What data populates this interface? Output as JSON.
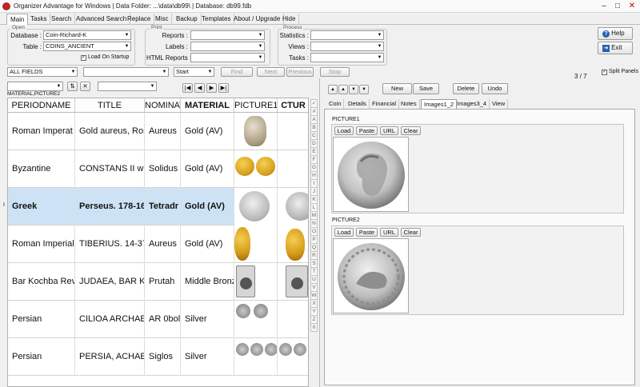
{
  "titlebar": {
    "title": "Organizer Advantage for Windows | Data Folder: ...\\data\\db99\\ | Database: db99.fdb",
    "minimize": "–",
    "maximize": "□",
    "close": "✕"
  },
  "menu_tabs": [
    "Main",
    "Tasks",
    "Search",
    "Advanced Search",
    "Replace",
    "Misc",
    "Backup",
    "Templates",
    "About / Upgrade",
    "Hide"
  ],
  "open_group": {
    "label": "Open",
    "database_label": "Database :",
    "database_value": "Coin-Richard-K",
    "table_label": "Table :",
    "table_value": "COINS_ANCIENT",
    "load_on_startup": "Load On Startup"
  },
  "print_group": {
    "label": "Print",
    "reports": "Reports :",
    "labels": "Labels :",
    "html_reports": "HTML Reports :"
  },
  "process_group": {
    "label": "Process",
    "statistics": "Statistics :",
    "views": "Views :",
    "tasks": "Tasks :"
  },
  "help_label": "Help",
  "exit_label": "Exit",
  "search": {
    "field": "ALL FIELDS",
    "mode": "Start",
    "find": "Find",
    "next": "Next",
    "previous": "Previous",
    "stop": "Stop"
  },
  "record_counter": "3 / 7",
  "split_panels": "Split Panels",
  "sort_label": "MATERIAL,PICTURE2",
  "grid": {
    "columns": [
      "PERIODNAME",
      "TITLE",
      "NOMINAT",
      "MATERIAL",
      "PICTURE1",
      "CTUR"
    ],
    "rows": [
      {
        "period": "Roman Imperat",
        "title": "Gold aureus, Rom",
        "nominal": "Aureus",
        "material": "Gold (AV)"
      },
      {
        "period": "Byzantine",
        "title": "CONSTANS II wit",
        "nominal": "Solidus",
        "material": "Gold (AV)"
      },
      {
        "period": "Greek",
        "title": "Perseus. 178-16",
        "nominal": "Tetradr",
        "material": "Gold (AV)"
      },
      {
        "period": "Roman Imperial",
        "title": "TIBERIUS. 14-37",
        "nominal": "Aureus",
        "material": "Gold (AV)"
      },
      {
        "period": "Bar Kochba Rev",
        "title": "JUDAEA, BAR KO(",
        "nominal": "Prutah",
        "material": "Middle Bronz"
      },
      {
        "period": "Persian",
        "title": "CILIOA ARCHAEM",
        "nominal": "AR 0bol",
        "material": "Silver"
      },
      {
        "period": "Persian",
        "title": "PERSIA, ACHAEM",
        "nominal": "Siglos",
        "material": "Silver"
      }
    ]
  },
  "alpha_bar": [
    "✓",
    "#",
    "A",
    "B",
    "C",
    "D",
    "E",
    "F",
    "G",
    "H",
    "I",
    "J",
    "K",
    "L",
    "M",
    "N",
    "O",
    "P",
    "Q",
    "R",
    "S",
    "T",
    "U",
    "V",
    "W",
    "X",
    "Y",
    "Z",
    "0"
  ],
  "record_buttons": {
    "new": "New",
    "save": "Save",
    "delete": "Delete",
    "undo": "Undo"
  },
  "detail_tabs": [
    "Coin",
    "Details",
    "Financial",
    "Notes",
    "Images1_2",
    "Images3_4",
    "View"
  ],
  "picture1": {
    "label": "PICTURE1",
    "load": "Load",
    "paste": "Paste",
    "url": "URL",
    "clear": "Clear"
  },
  "picture2": {
    "label": "PICTURE2",
    "load": "Load",
    "paste": "Paste",
    "url": "URL",
    "clear": "Clear"
  },
  "colors": {
    "selection": "#cde3f5",
    "gold": "#d9a320",
    "silver": "#b9b9b9",
    "brand": "#b8262b"
  }
}
